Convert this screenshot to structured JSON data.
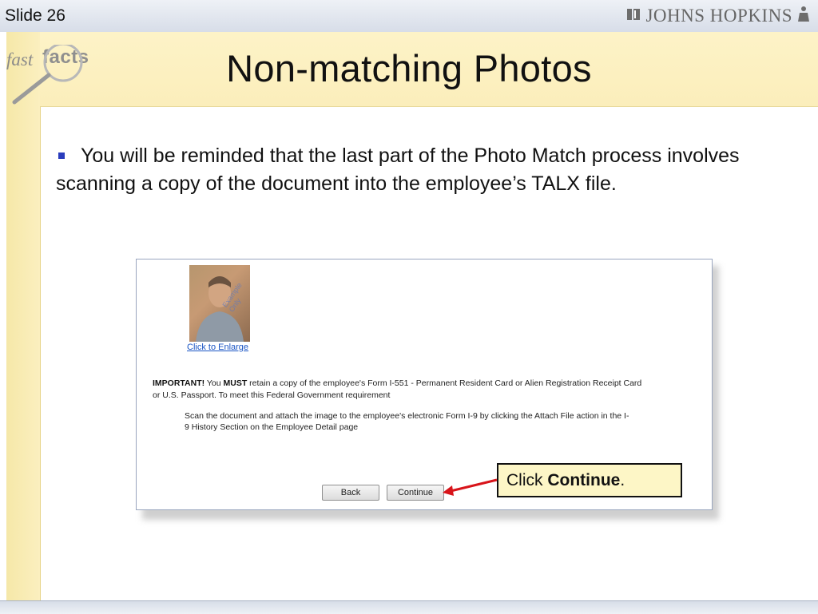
{
  "header": {
    "slide_label": "Slide 26",
    "brand_name": "JOHNS HOPKINS"
  },
  "logo": {
    "word1": "fast",
    "word2": "facts"
  },
  "title": "Non-matching Photos",
  "bullet": {
    "text": "You will be reminded that the last part of the Photo Match process involves scanning a copy of the document into the employee’s TALX file."
  },
  "screenshot": {
    "photo_watermark": "Example Only",
    "enlarge_link": "Click to Enlarge",
    "important_label": "IMPORTANT!",
    "important_you": " You ",
    "must": "MUST",
    "important_rest": " retain a copy of the employee's Form I-551 - Permanent Resident Card or Alien Registration Receipt Card or U.S. Passport.  To meet this Federal Government requirement",
    "scan_text": "Scan the document and attach the image to the employee's electronic Form I-9 by clicking the Attach File action in the I-9 History Section on the Employee Detail page",
    "back_button": "Back",
    "continue_button": "Continue"
  },
  "callout": {
    "prefix": "Click ",
    "bold": "Continue",
    "suffix": "."
  },
  "colors": {
    "accent_blue": "#2a3dbd",
    "band_yellow": "#fbeebb",
    "arrow_red": "#d8141a"
  },
  "icons": [
    "shield-icon",
    "seated-figure-icon",
    "magnifier-icon",
    "bullet-square-icon",
    "arrow-icon"
  ]
}
